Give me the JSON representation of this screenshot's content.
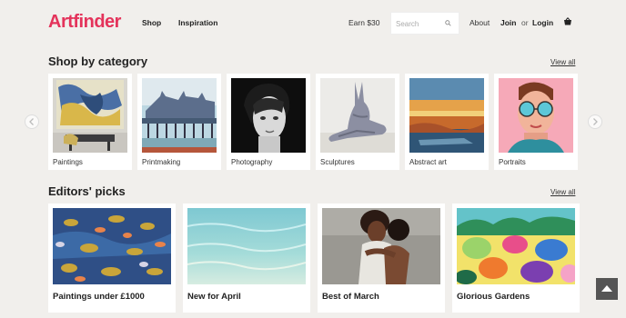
{
  "header": {
    "logo": "Artfinder",
    "nav": [
      "Shop",
      "Inspiration"
    ],
    "earn": "Earn $30",
    "search_placeholder": "Search",
    "about": "About",
    "join": "Join",
    "or": "or",
    "login": "Login"
  },
  "categories": {
    "title": "Shop by category",
    "view_all": "View all",
    "items": [
      {
        "label": "Paintings"
      },
      {
        "label": "Printmaking"
      },
      {
        "label": "Photography"
      },
      {
        "label": "Sculptures"
      },
      {
        "label": "Abstract art"
      },
      {
        "label": "Portraits"
      }
    ]
  },
  "editors": {
    "title": "Editors' picks",
    "view_all": "View all",
    "items": [
      {
        "label": "Paintings under £1000"
      },
      {
        "label": "New for April"
      },
      {
        "label": "Best of March"
      },
      {
        "label": "Glorious Gardens"
      }
    ]
  },
  "colors": {
    "brand": "#e4335b",
    "background": "#f1efec"
  },
  "icons": {
    "search": "search-icon",
    "basket": "basket-icon",
    "prev": "chevron-left-icon",
    "next": "chevron-right-icon",
    "scroll_top": "arrow-up-icon"
  }
}
